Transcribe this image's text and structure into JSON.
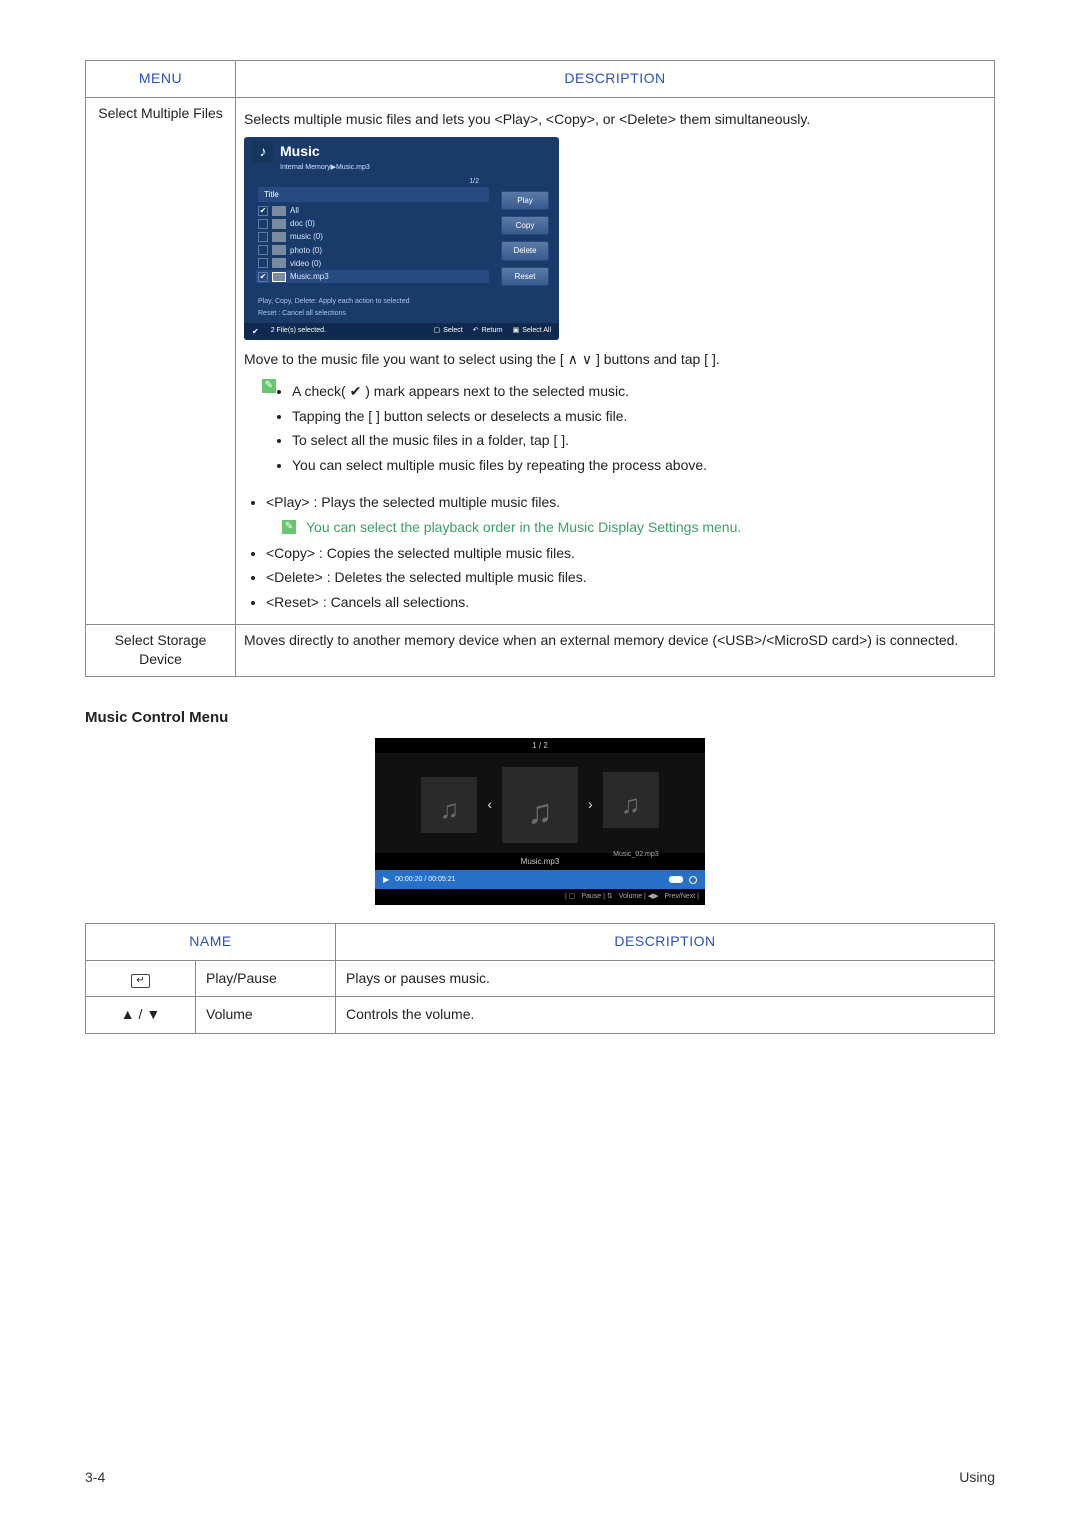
{
  "table_main": {
    "headers": {
      "menu": "MENU",
      "description": "DESCRIPTION"
    },
    "rows": [
      {
        "menu": "Select Multiple Files",
        "desc_top": "Selects multiple music files and lets you <Play>, <Copy>, or <Delete> them simultaneously.",
        "music_panel": {
          "title": "Music",
          "path": "Internal Memory▶Music.mp3",
          "pager": "1/2",
          "list_header": "Title",
          "items": [
            {
              "checked": true,
              "name": "All"
            },
            {
              "checked": false,
              "name": "doc (0)"
            },
            {
              "checked": false,
              "name": "music (0)"
            },
            {
              "checked": false,
              "name": "photo (0)"
            },
            {
              "checked": false,
              "name": "video (0)"
            },
            {
              "checked": true,
              "name": "Music.mp3",
              "selected": true
            }
          ],
          "buttons": [
            "Play",
            "Copy",
            "Delete",
            "Reset"
          ],
          "hint1": "Play, Copy, Delete: Apply each action to selected",
          "hint2": "Reset : Cancel all selections",
          "footer": {
            "selected": "2 File(s) selected.",
            "select": "Select",
            "return": "Return",
            "select_all": "Select All"
          }
        },
        "move_line": "Move to the music file you want to select using the [ ∧ ∨ ] buttons and tap [      ].",
        "bullets1": [
          "A check( ✔ ) mark appears next to the selected music.",
          "Tapping the [      ] button selects or deselects a music file.",
          "To select all the music files in a folder, tap [      ].",
          "You can select multiple music files by repeating the process above."
        ],
        "play_line": "<Play> : Plays the selected multiple music files.",
        "note_play": "You can select the playback order in the Music Display Settings menu.",
        "bullets2": [
          "<Copy> : Copies the selected multiple music files.",
          "<Delete> : Deletes the selected multiple music files.",
          "<Reset> : Cancels all selections."
        ]
      },
      {
        "menu": "Select Storage Device",
        "desc": "Moves directly to another memory device when an external memory device (<USB>/<MicroSD card>) is connected."
      }
    ]
  },
  "section_title": "Music Control Menu",
  "player": {
    "pager": "1 / 2",
    "side_label": "Music_02.mp3",
    "current": "Music.mp3",
    "time": "00:00:20 / 00:05:21",
    "foot_pause": "Pause",
    "foot_volume": "Volume",
    "foot_prevnext": "Prev/Next"
  },
  "table_ctrl": {
    "headers": {
      "name": "NAME",
      "description": "DESCRIPTION"
    },
    "rows": [
      {
        "icon": "enter",
        "name": "Play/Pause",
        "desc": "Plays or pauses music."
      },
      {
        "icon": "updown",
        "name": "Volume",
        "desc": "Controls the volume."
      }
    ]
  },
  "footer": {
    "left": "3-4",
    "right": "Using"
  }
}
